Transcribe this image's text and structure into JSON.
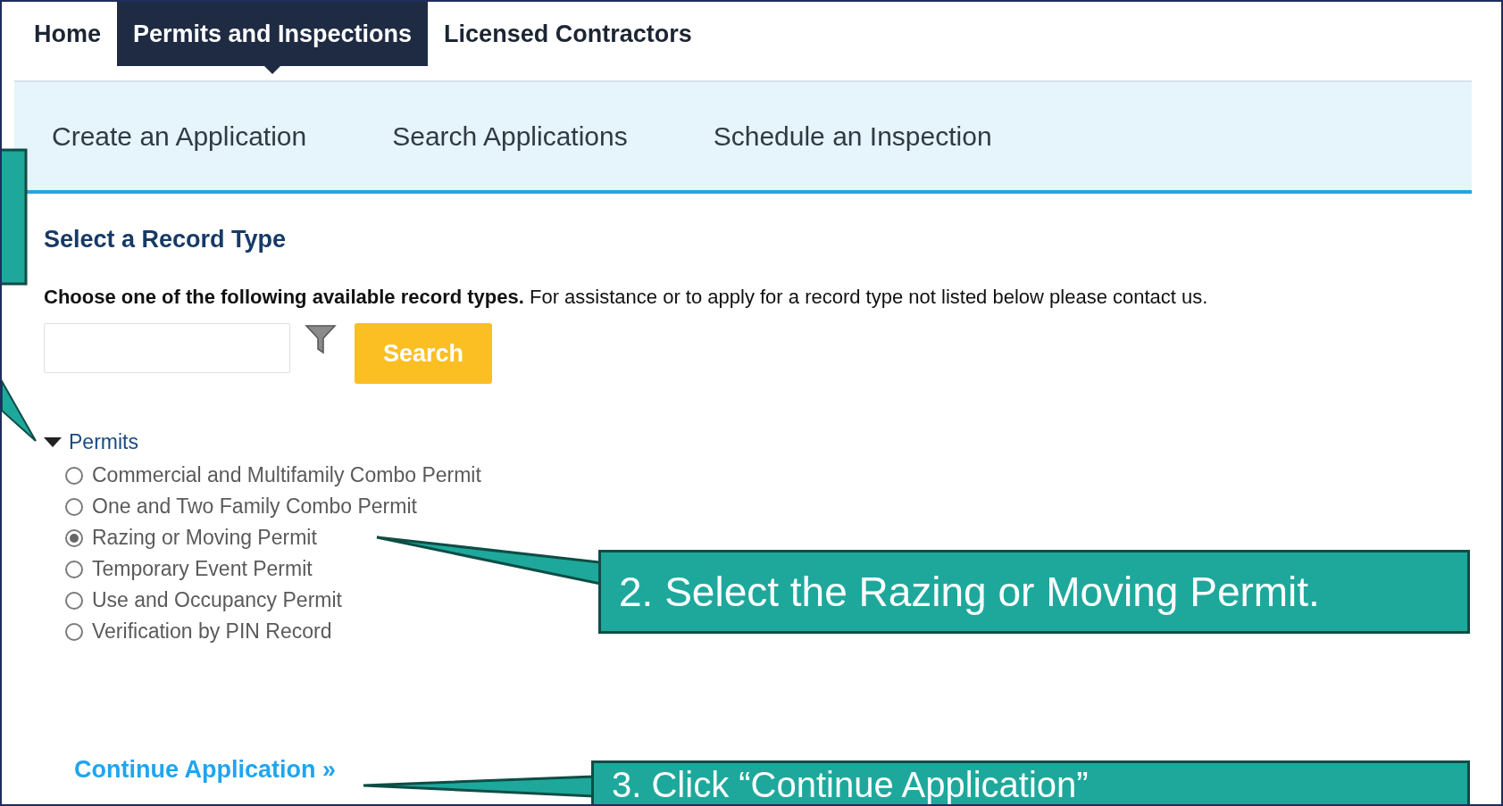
{
  "top_nav": [
    {
      "label": "Home",
      "selected": false
    },
    {
      "label": "Permits and Inspections",
      "selected": true
    },
    {
      "label": "Licensed Contractors",
      "selected": false
    }
  ],
  "sub_nav": [
    "Create an Application",
    "Search Applications",
    "Schedule an Inspection"
  ],
  "heading": "Select a Record Type",
  "instructions": "**Choose one of the following available record types.** For assistance or to apply for a record type not listed below please contact us.",
  "search": {
    "button": "Search"
  },
  "tree": {
    "label": "Permits",
    "expanded": true,
    "children": [
      {
        "label": "Commercial and Multifamily Combo Permit",
        "selected": false
      },
      {
        "label": "One and Two Family Combo Permit",
        "selected": false
      },
      {
        "label": "Razing or Moving Permit",
        "selected": true
      },
      {
        "label": "Temporary Event Permit",
        "selected": false
      },
      {
        "label": "Use and Occupancy Permit",
        "selected": false
      },
      {
        "label": "Verification by PIN Record",
        "selected": false
      }
    ]
  },
  "continue_link": "Continue Application »",
  "callouts": [
    {
      "text": "2. Select the Razing or Moving Permit."
    },
    {
      "text": "3. Click “Continue Application”"
    }
  ]
}
